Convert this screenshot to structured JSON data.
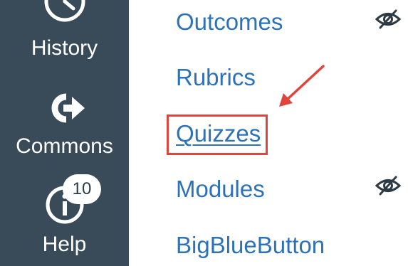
{
  "global_nav": {
    "history_label": "History",
    "commons_label": "Commons",
    "help_label": "Help",
    "help_badge_count": "10",
    "icons": {
      "history": "clock-icon",
      "commons": "commons-arrow-icon",
      "help": "info-icon"
    }
  },
  "course_nav": {
    "items": [
      {
        "label": "Outcomes",
        "hidden_icon": "eye-slash-icon"
      },
      {
        "label": "Rubrics"
      },
      {
        "label": "Quizzes",
        "active": true
      },
      {
        "label": "Modules",
        "hidden_icon": "eye-slash-icon"
      },
      {
        "label": "BigBlueButton"
      }
    ]
  },
  "annotation": {
    "highlight_color": "#e0443c",
    "target": "Quizzes"
  },
  "colors": {
    "sidebar_bg": "#394b58",
    "link": "#2d72b8",
    "hidden_icon": "#2d3b45"
  }
}
